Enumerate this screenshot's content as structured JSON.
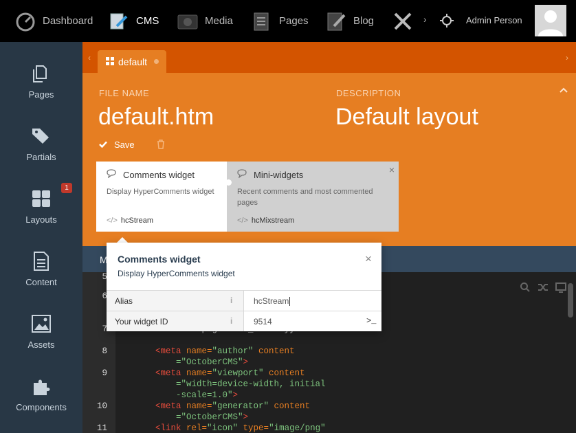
{
  "topbar": {
    "nav": [
      {
        "label": "Dashboard",
        "icon": "dashboard-icon"
      },
      {
        "label": "CMS",
        "icon": "cms-icon"
      },
      {
        "label": "Media",
        "icon": "media-icon"
      },
      {
        "label": "Pages",
        "icon": "pages-icon"
      },
      {
        "label": "Blog",
        "icon": "blog-icon"
      },
      {
        "label": "",
        "icon": "tools-icon"
      }
    ],
    "more_glyph": "›",
    "admin_name": "Admin Person"
  },
  "sidebar": {
    "items": [
      {
        "label": "Pages",
        "icon": "pages-icon"
      },
      {
        "label": "Partials",
        "icon": "partials-icon"
      },
      {
        "label": "Layouts",
        "icon": "layouts-icon",
        "badge": "1"
      },
      {
        "label": "Content",
        "icon": "content-icon"
      },
      {
        "label": "Assets",
        "icon": "assets-icon"
      },
      {
        "label": "Components",
        "icon": "components-icon"
      }
    ]
  },
  "tabs": {
    "active": "default"
  },
  "form": {
    "file_name_label": "FILE NAME",
    "file_name_value": "default.htm",
    "description_label": "DESCRIPTION",
    "description_value": "Default layout",
    "save_label": "Save"
  },
  "widgets": [
    {
      "title": "Comments widget",
      "description": "Display HyperComments widget",
      "alias": "hcStream"
    },
    {
      "title": "Mini-widgets",
      "description": "Recent comments and most commented pages",
      "alias": "hcMixstream"
    }
  ],
  "editor": {
    "bar_text": "M",
    "lines": [
      {
        "n": "5",
        "parts": []
      },
      {
        "n": "6",
        "parts": []
      },
      {
        "n": "7",
        "parts": [
          {
            "c": "txt",
            "t": "    this.page.meta_title }}\">"
          }
        ]
      },
      {
        "n": "8",
        "parts": [
          {
            "c": "tag",
            "t": "<meta "
          },
          {
            "c": "attr",
            "t": "name="
          },
          {
            "c": "str",
            "t": "\"author\" "
          },
          {
            "c": "attr",
            "t": "content"
          }
        ]
      },
      {
        "n": "",
        "parts": [
          {
            "c": "str",
            "t": "    =\"OctoberCMS\""
          },
          {
            "c": "tag",
            "t": ">"
          }
        ]
      },
      {
        "n": "9",
        "parts": [
          {
            "c": "tag",
            "t": "<meta "
          },
          {
            "c": "attr",
            "t": "name="
          },
          {
            "c": "str",
            "t": "\"viewport\" "
          },
          {
            "c": "attr",
            "t": "content"
          }
        ]
      },
      {
        "n": "",
        "parts": [
          {
            "c": "str",
            "t": "    =\"width=device-width, initial"
          }
        ]
      },
      {
        "n": "",
        "parts": [
          {
            "c": "str",
            "t": "    -scale=1.0\""
          },
          {
            "c": "tag",
            "t": ">"
          }
        ]
      },
      {
        "n": "10",
        "parts": [
          {
            "c": "tag",
            "t": "<meta "
          },
          {
            "c": "attr",
            "t": "name="
          },
          {
            "c": "str",
            "t": "\"generator\" "
          },
          {
            "c": "attr",
            "t": "content"
          }
        ]
      },
      {
        "n": "",
        "parts": [
          {
            "c": "str",
            "t": "    =\"OctoberCMS\""
          },
          {
            "c": "tag",
            "t": ">"
          }
        ]
      },
      {
        "n": "11",
        "parts": [
          {
            "c": "tag",
            "t": "<link "
          },
          {
            "c": "attr",
            "t": "rel="
          },
          {
            "c": "str",
            "t": "\"icon\" "
          },
          {
            "c": "attr",
            "t": "type="
          },
          {
            "c": "str",
            "t": "\"image/png\""
          }
        ]
      }
    ]
  },
  "popup": {
    "title": "Comments widget",
    "description": "Display HyperComments widget",
    "close_glyph": "×",
    "properties": [
      {
        "name": "Alias",
        "value": "hcStream",
        "info": "i"
      },
      {
        "name": "Your widget ID",
        "value": "9514",
        "info": "i",
        "action": ">_"
      }
    ]
  },
  "colors": {
    "topbar": "#000000",
    "sidebar": "#283745",
    "orange": "#e67e22",
    "tabstrip": "#d35400",
    "badge": "#c0392b"
  }
}
